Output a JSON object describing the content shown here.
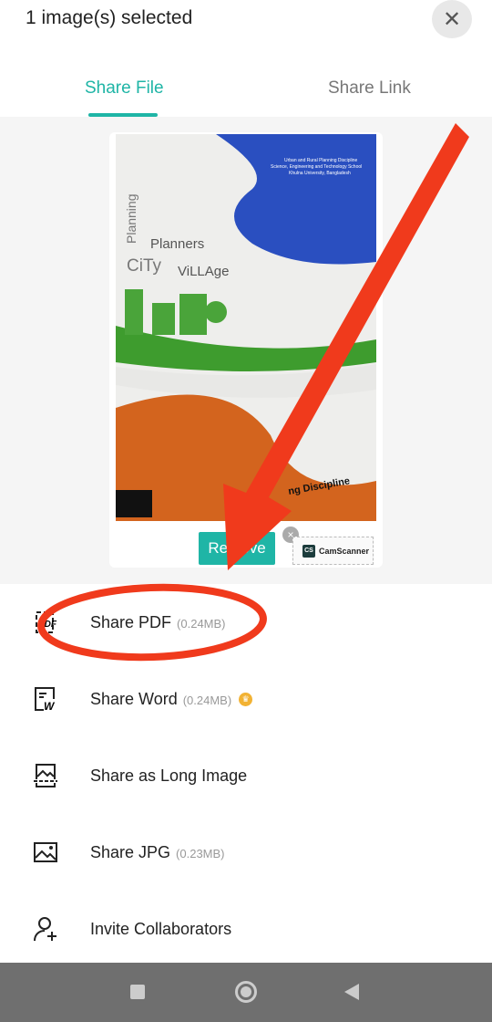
{
  "header": {
    "title": "1 image(s) selected",
    "close_icon": "close-icon"
  },
  "tabs": [
    {
      "label": "Share File",
      "active": true
    },
    {
      "label": "Share Link",
      "active": false
    }
  ],
  "preview": {
    "cover_texts": {
      "t1": "Planning",
      "t2": "Planners",
      "t3": "CiTy",
      "t4": "ViLLAge",
      "t5": "ng Discipline",
      "t6": "Urban and Rural Planning Discipline",
      "t7": "Science, Engineering and Technology School",
      "t8": "Khulna University, Bangladesh"
    },
    "remove_label": "Remove",
    "watermark_label": "CamScanner",
    "watermark_logo": "CS"
  },
  "options": [
    {
      "label": "Share PDF",
      "size": "(0.24MB)",
      "icon": "pdf-icon"
    },
    {
      "label": "Share Word",
      "size": "(0.24MB)",
      "icon": "word-icon",
      "premium": true
    },
    {
      "label": "Share as Long Image",
      "size": "",
      "icon": "long-image-icon"
    },
    {
      "label": "Share JPG",
      "size": "(0.23MB)",
      "icon": "image-icon"
    },
    {
      "label": "Invite Collaborators",
      "size": "",
      "icon": "add-user-icon"
    }
  ],
  "colors": {
    "accent": "#1fb5a6",
    "annotation": "#f03a1c",
    "premium": "#f2b233"
  }
}
